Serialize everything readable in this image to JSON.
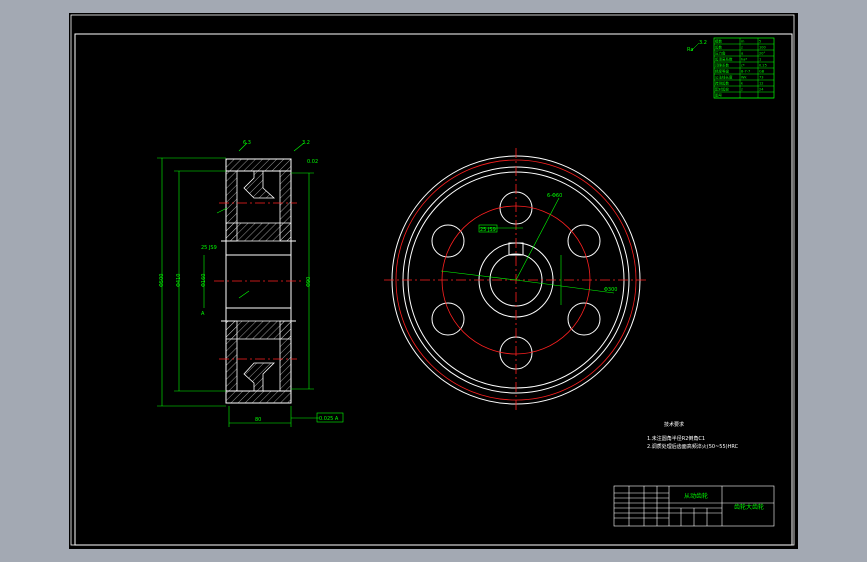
{
  "viewport": {
    "background": "#000000",
    "app_background": "#a3a9b3"
  },
  "colors": {
    "frame": "#ffffff",
    "centerline": "#ff2020",
    "dimension": "#00ff00",
    "hatch": "#ffffff"
  },
  "param_table": {
    "rows": [
      [
        "模数",
        "m",
        "5"
      ],
      [
        "齿数",
        "z",
        "100"
      ],
      [
        "压力角",
        "α",
        "20°"
      ],
      [
        "齿顶高系数",
        "ha*",
        "1"
      ],
      [
        "顶隙系数",
        "c*",
        "0.25"
      ],
      [
        "精度等级",
        "8-7-7",
        "GB"
      ],
      [
        "公法线长度",
        "Wk",
        "73"
      ],
      [
        "跨测齿数",
        "k",
        "12"
      ],
      [
        "配对齿轮",
        "z",
        "24"
      ],
      [
        "图号",
        "",
        ""
      ]
    ]
  },
  "notes": {
    "title": "技术要求",
    "lines": [
      "1.未注圆角半径R2倒角C1",
      "2.调质处理后齿面高频淬火(50~55)HRC"
    ]
  },
  "title_block": {
    "part_name": "从动齿轮",
    "drawing_name": "齿轮大齿轮"
  },
  "annotations": {
    "roughness_top_left": "6.3",
    "roughness_top_right": "3.2",
    "tolerance_top": "0.02",
    "datum_box": "0.025 A",
    "datum_label": "A",
    "dia_left": "Φ500",
    "dia_inner": "Φ410",
    "dia_hub": "Φ160",
    "dia_bore": "Φ90",
    "width": "80",
    "keyway_label": "25 JS9",
    "hole_label": "6-Φ60",
    "pitch_label": "Φ300",
    "roughness_corner": "3.2",
    "corner_label": "Ra"
  }
}
